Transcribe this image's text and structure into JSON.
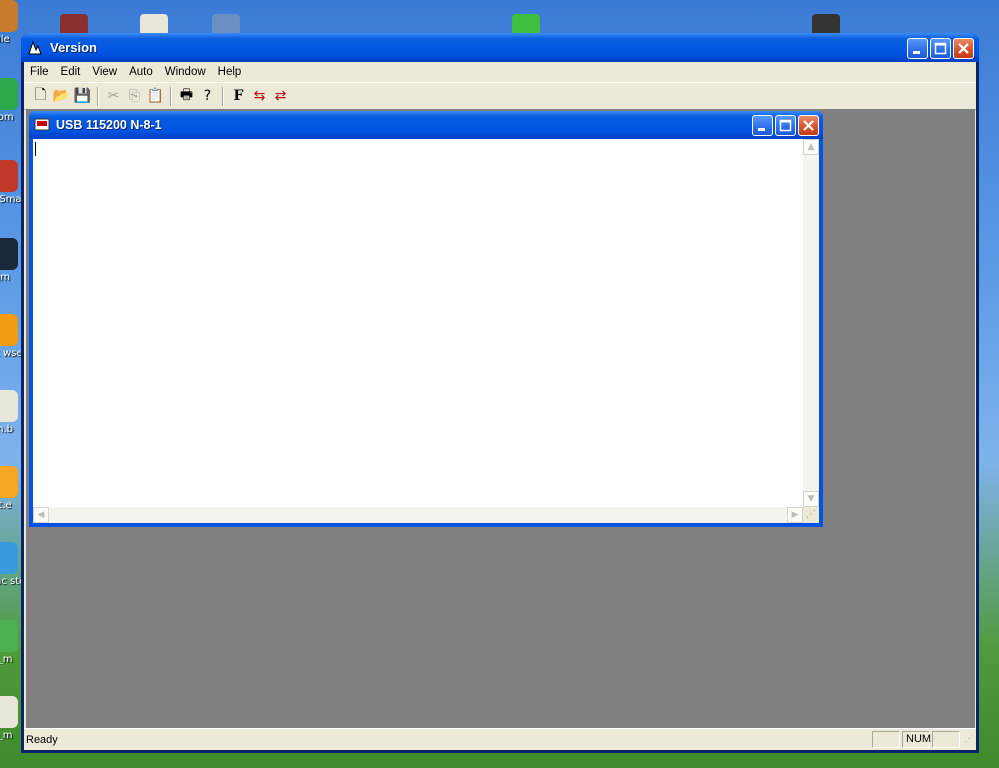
{
  "desktop": {
    "icons": [
      {
        "label": "ule",
        "color": "#c87a2e"
      },
      {
        "label": "Hom",
        "color": "#2ca84b"
      },
      {
        "label": "ero Smar",
        "color": "#c0392b"
      },
      {
        "label": "am",
        "color": "#1b2838"
      },
      {
        "label": "met wser",
        "color": "#f39c12"
      },
      {
        "label": "en.b",
        "color": "#e8e6d9"
      },
      {
        "label": "et.e",
        "color": "#f5a623"
      },
      {
        "label": "nloac ster",
        "color": "#3a9bdc"
      },
      {
        "label": "n_m",
        "color": "#4caf50"
      },
      {
        "label": "n_m",
        "color": "#e8e6d9"
      }
    ]
  },
  "app": {
    "title": "Version",
    "menu": [
      "File",
      "Edit",
      "View",
      "Auto",
      "Window",
      "Help"
    ],
    "toolbar": [
      {
        "name": "new-icon",
        "glyph": "🗋",
        "enabled": true
      },
      {
        "name": "open-icon",
        "glyph": "📂",
        "enabled": true
      },
      {
        "name": "save-icon",
        "glyph": "💾",
        "enabled": true
      },
      {
        "sep": true
      },
      {
        "name": "cut-icon",
        "glyph": "✂",
        "enabled": false
      },
      {
        "name": "copy-icon",
        "glyph": "⎘",
        "enabled": false
      },
      {
        "name": "paste-icon",
        "glyph": "📋",
        "enabled": true
      },
      {
        "sep": true
      },
      {
        "name": "print-icon",
        "glyph": "🖶",
        "enabled": true
      },
      {
        "name": "help-icon",
        "glyph": "?",
        "enabled": true
      },
      {
        "sep": true
      },
      {
        "name": "font-icon",
        "glyph": "F",
        "enabled": true
      },
      {
        "name": "send-icon",
        "glyph": "⇆",
        "enabled": true
      },
      {
        "name": "receive-icon",
        "glyph": "⇄",
        "enabled": true
      }
    ]
  },
  "child": {
    "title": "USB 115200  N-8-1"
  },
  "status": {
    "text": "Ready",
    "num": "NUM"
  }
}
